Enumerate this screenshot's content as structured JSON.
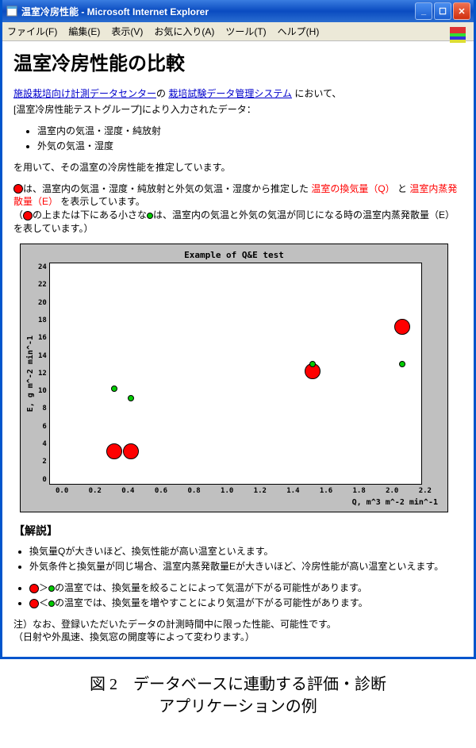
{
  "window": {
    "title": "温室冷房性能 - Microsoft Internet Explorer"
  },
  "menu": {
    "file": "ファイル(F)",
    "edit": "編集(E)",
    "view": "表示(V)",
    "fav": "お気に入り(A)",
    "tools": "ツール(T)",
    "help": "ヘルプ(H)"
  },
  "page": {
    "h1": "温室冷房性能の比較",
    "link1": "施設栽培向け計測データセンター",
    "intro_mid": "の ",
    "link2": "栽培試験データ管理システム",
    "intro_tail": " において、",
    "bracket": "[温室冷房性能テストグループ]により入力されたデータ：",
    "bullet1": "温室内の気温・湿度・純放射",
    "bullet2": "外気の気温・湿度",
    "para1": "を用いて、その温室の冷房性能を推定しています。",
    "redpara_a": "は、温室内の気温・湿度・純放射と外気の気温・湿度から推定した ",
    "redpara_q": "温室の換気量（Q）",
    "redpara_and": " と ",
    "redpara_e": "温室内蒸発散量（E）",
    "redpara_b": " を表示しています。",
    "parenline_a": "（",
    "parenline_b": "の上または下にある小さな",
    "parenline_c": "は、温室内の気温と外気の気温が同じになる時の温室内蒸発散量（E）を表しています。）",
    "section": "【解説】",
    "exp1": "換気量Qが大きいほど、換気性能が高い温室といえます。",
    "exp2": "外気条件と換気量が同じ場合、温室内蒸発散量Eが大きいほど、冷房性能が高い温室といえます。",
    "exp3_a": "＞",
    "exp3_b": "の温室では、換気量を絞ることによって気温が下がる可能性があります。",
    "exp4_a": "＜",
    "exp4_b": "の温室では、換気量を増やすことにより気温が下がる可能性があります。",
    "note1": "注）なお、登録いただいたデータの計測時間中に限った性能、可能性です。",
    "note2": "（日射や外風速、換気窓の開度等によって変わります。）"
  },
  "chart_data": {
    "type": "scatter",
    "title": "Example of Q&E test",
    "xlabel": "Q, m^3 m^-2 min^-1",
    "ylabel": "E, g m^-2 min^-1",
    "xlim": [
      0.0,
      2.2
    ],
    "ylim": [
      0,
      24
    ],
    "xticks": [
      "0.0",
      "0.2",
      "0.4",
      "0.6",
      "0.8",
      "1.0",
      "1.2",
      "1.4",
      "1.6",
      "1.8",
      "2.0",
      "2.2"
    ],
    "yticks": [
      "24",
      "22",
      "20",
      "18",
      "16",
      "14",
      "12",
      "10",
      "8",
      "6",
      "4",
      "2",
      "0"
    ],
    "series": [
      {
        "name": "red-large",
        "color": "#ff0000",
        "points": [
          {
            "x": 0.38,
            "y": 3.5
          },
          {
            "x": 0.48,
            "y": 3.5
          },
          {
            "x": 1.55,
            "y": 12.2
          },
          {
            "x": 2.08,
            "y": 17.0
          }
        ]
      },
      {
        "name": "green-small",
        "color": "#00cc00",
        "points": [
          {
            "x": 0.38,
            "y": 10.3
          },
          {
            "x": 0.48,
            "y": 9.3
          },
          {
            "x": 1.55,
            "y": 13.0
          },
          {
            "x": 2.08,
            "y": 13.0
          }
        ]
      }
    ]
  },
  "caption": {
    "line1": "図 2　データベースに連動する評価・診断",
    "line2": "アプリケーションの例"
  }
}
